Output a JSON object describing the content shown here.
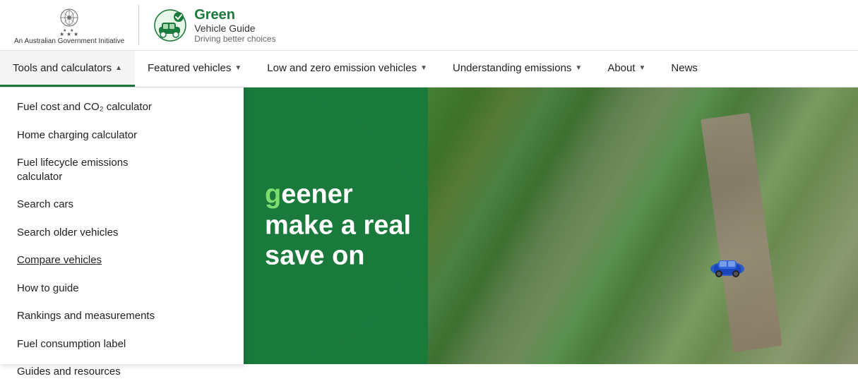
{
  "header": {
    "gov_label": "An Australian Government Initiative",
    "brand_green": "Green",
    "brand_vehicle": "Vehicle Guide",
    "brand_tagline": "Driving better choices"
  },
  "nav": {
    "items": [
      {
        "id": "tools",
        "label": "Tools and calculators",
        "has_dropdown": true,
        "active": true
      },
      {
        "id": "featured",
        "label": "Featured vehicles",
        "has_dropdown": true,
        "active": false
      },
      {
        "id": "low-emission",
        "label": "Low and zero emission vehicles",
        "has_dropdown": true,
        "active": false
      },
      {
        "id": "understanding",
        "label": "Understanding emissions",
        "has_dropdown": true,
        "active": false
      },
      {
        "id": "about",
        "label": "About",
        "has_dropdown": true,
        "active": false
      },
      {
        "id": "news",
        "label": "News",
        "has_dropdown": false,
        "active": false
      }
    ]
  },
  "dropdown": {
    "items": [
      {
        "id": "fuel-cost",
        "label": "Fuel cost and CO₂ calculator",
        "underlined": false
      },
      {
        "id": "home-charging",
        "label": "Home charging calculator",
        "underlined": false
      },
      {
        "id": "fuel-lifecycle",
        "label": "Fuel lifecycle emissions calculator",
        "underlined": false
      },
      {
        "id": "search-cars",
        "label": "Search cars",
        "underlined": false
      },
      {
        "id": "search-older",
        "label": "Search older vehicles",
        "underlined": false
      },
      {
        "id": "compare",
        "label": "Compare vehicles",
        "underlined": true
      },
      {
        "id": "how-to",
        "label": "How to guide",
        "underlined": false
      },
      {
        "id": "rankings",
        "label": "Rankings and measurements",
        "underlined": false
      },
      {
        "id": "fuel-label",
        "label": "Fuel consumption label",
        "underlined": false
      },
      {
        "id": "guides",
        "label": "Guides and resources",
        "underlined": false
      }
    ]
  },
  "hero": {
    "text_line1": "eener",
    "text_line2": "make a real",
    "text_line3": "save on"
  }
}
